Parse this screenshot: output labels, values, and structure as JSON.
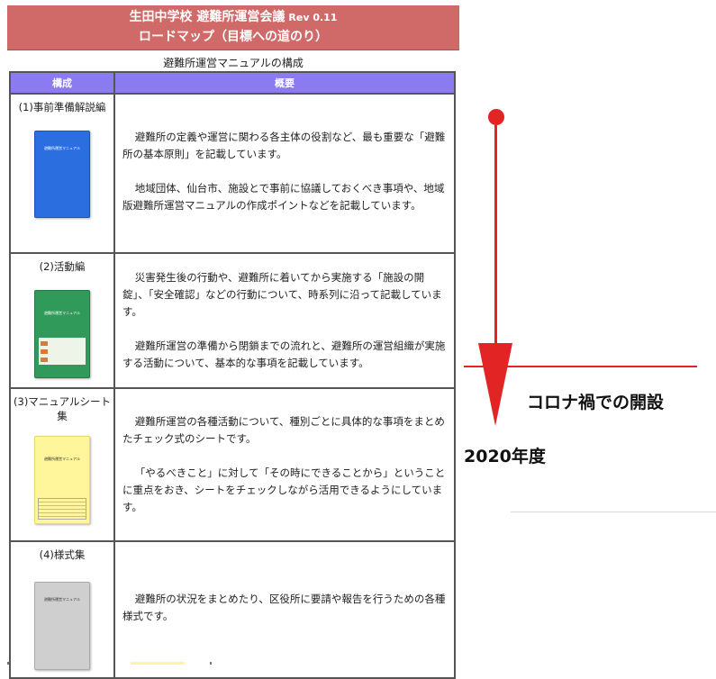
{
  "header": {
    "title_prefix": "生田中学校 避難所運営会議",
    "revision": "Rev 0.11",
    "subtitle": "ロードマップ（目標への道のり）"
  },
  "table": {
    "caption": "避難所運営マニュアルの構成",
    "columns": [
      "構成",
      "概要"
    ],
    "rows": [
      {
        "name": "(1)事前準備解説編",
        "cover_color": "#2a6ee0",
        "cover_label": "避難所運営マニュアル",
        "paragraphs": [
          "避難所の定義や運営に関わる各主体の役割など、最も重要な「避難所の基本原則」を記載しています。",
          "地域団体、仙台市、施設とで事前に協議しておくべき事項や、地域版避難所運営マニュアルの作成ポイントなどを記載しています。"
        ]
      },
      {
        "name": "(2)活動編",
        "cover_color": "#2f9a5a",
        "cover_label": "避難所運営マニュアル",
        "paragraphs": [
          "災害発生後の行動や、避難所に着いてから実施する「施設の開錠」、「安全確認」などの行動について、時系列に沿って記載しています。",
          "避難所運営の準備から閉鎖までの流れと、避難所の運営組織が実施する活動について、基本的な事項を記載しています。"
        ]
      },
      {
        "name": "(3)マニュアルシート集",
        "cover_color": "#fff59b",
        "cover_label": "避難所運営マニュアル",
        "paragraphs": [
          "避難所運営の各種活動について、種別ごとに具体的な事項をまとめたチェック式のシートです。",
          "「やるべきこと」に対して「その時にできることから」ということに重点をおき、シートをチェックしながら活用できるようにしています。"
        ]
      },
      {
        "name": "(4)様式集",
        "cover_color": "#cfcfcf",
        "cover_label": "避難所運営マニュアル",
        "paragraphs": [
          "避難所の状況をまとめたり、区役所に要請や報告を行うための各種様式です。"
        ]
      }
    ]
  },
  "timeline": {
    "color": "#e22424",
    "event_label": "コロナ禍での開設",
    "year_label": "2020年度"
  }
}
